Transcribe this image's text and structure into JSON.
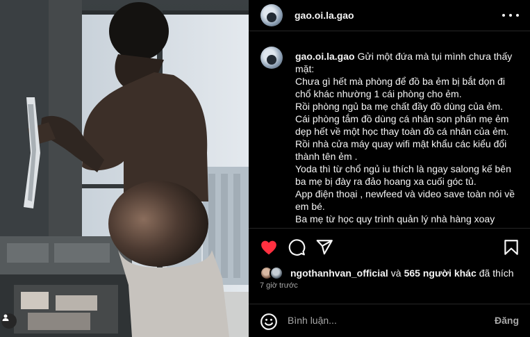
{
  "post": {
    "author": "gao.oi.la.gao",
    "colors": {
      "like_heart": "#ff3040",
      "muted_text": "#a8a8a8",
      "divider": "#262626"
    }
  },
  "header": {
    "username": "gao.oi.la.gao",
    "more_icon": "more-horizontal-icon"
  },
  "caption": {
    "username": "gao.oi.la.gao",
    "lines": [
      "Gửi một đứa mà tụi mình chưa thấy mặt:",
      "Chưa gì hết mà phòng để đồ ba ẻm bị bắt dọn đi chổ khác nhường 1 cái phòng cho ẻm.",
      "Rồi phòng ngủ ba mẹ chất đầy đồ dùng của ẻm.",
      "Cái phòng tắm đồ dùng cá nhân son phấn mẹ ẻm dẹp hết về một học thay toàn đồ cá nhân của ẻm.",
      "Rồi nhà cửa máy quay wifi mật khẩu các kiểu đổi thành tên ẻm .",
      "Yoda thì từ chổ ngủ iu thích là ngay salong kế bên ba mẹ bị đày ra đảo hoang xa cuối góc tủ.",
      "App điện thoại , newfeed và video save toàn nói về em bé.",
      "Ba mẹ từ học quy trình quản lý nhà hàng xoay"
    ]
  },
  "actions": {
    "like_icon": "heart-filled-icon",
    "comment_icon": "comment-icon",
    "share_icon": "share-icon",
    "save_icon": "bookmark-icon",
    "liked": true
  },
  "likes": {
    "first_user": "ngothanhvan_official",
    "connector": "và",
    "others": "565 người khác",
    "suffix": "đã thích"
  },
  "timestamp": "7 giờ trước",
  "comment": {
    "emoji_icon": "emoji-icon",
    "placeholder": "Bình luận...",
    "post_label": "Đăng"
  },
  "photo": {
    "tag_icon": "user-tag-icon"
  }
}
